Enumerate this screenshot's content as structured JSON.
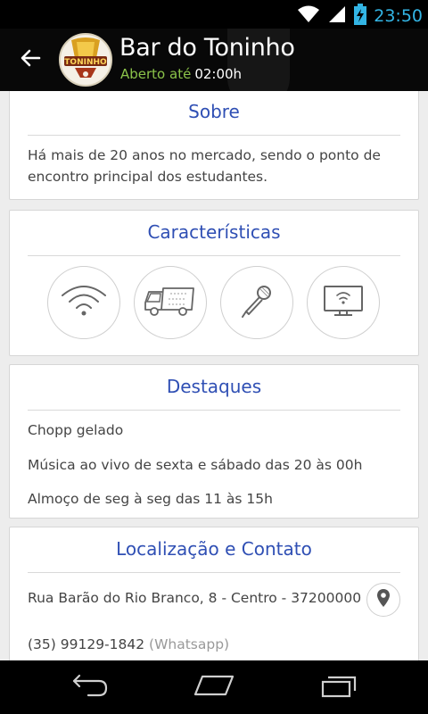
{
  "status_bar": {
    "time": "23:50",
    "icons": [
      "wifi-icon",
      "signal-icon",
      "battery-charging-icon"
    ]
  },
  "header": {
    "title": "Bar do Toninho",
    "open_label": "Aberto até",
    "open_until": "02:00h",
    "logo_text": "TONINHO",
    "back_icon": "arrow-back-icon"
  },
  "about": {
    "title": "Sobre",
    "text": "Há mais de 20 anos no mercado, sendo o ponto de encontro principal dos estudantes."
  },
  "features": {
    "title": "Características",
    "icons": [
      "wifi-icon",
      "delivery-truck-icon",
      "microphone-icon",
      "tv-icon"
    ]
  },
  "highlights": {
    "title": "Destaques",
    "items": [
      "Chopp gelado",
      "Música ao vivo de sexta e sábado das 20 às 00h",
      "Almoço de seg à seg das 11 às 15h"
    ]
  },
  "location": {
    "title": "Localização e Contato",
    "address": "Rua Barão do Rio Branco, 8 - Centro - 37200000",
    "phone": "(35) 99129-1842",
    "phone_note": "(Whatsapp)"
  },
  "nav": {
    "icons": [
      "back-nav-icon",
      "home-nav-icon",
      "recents-nav-icon"
    ]
  },
  "colors": {
    "accent": "#2f4fb4",
    "open": "#8bc34a",
    "status_time": "#33b5e5"
  }
}
